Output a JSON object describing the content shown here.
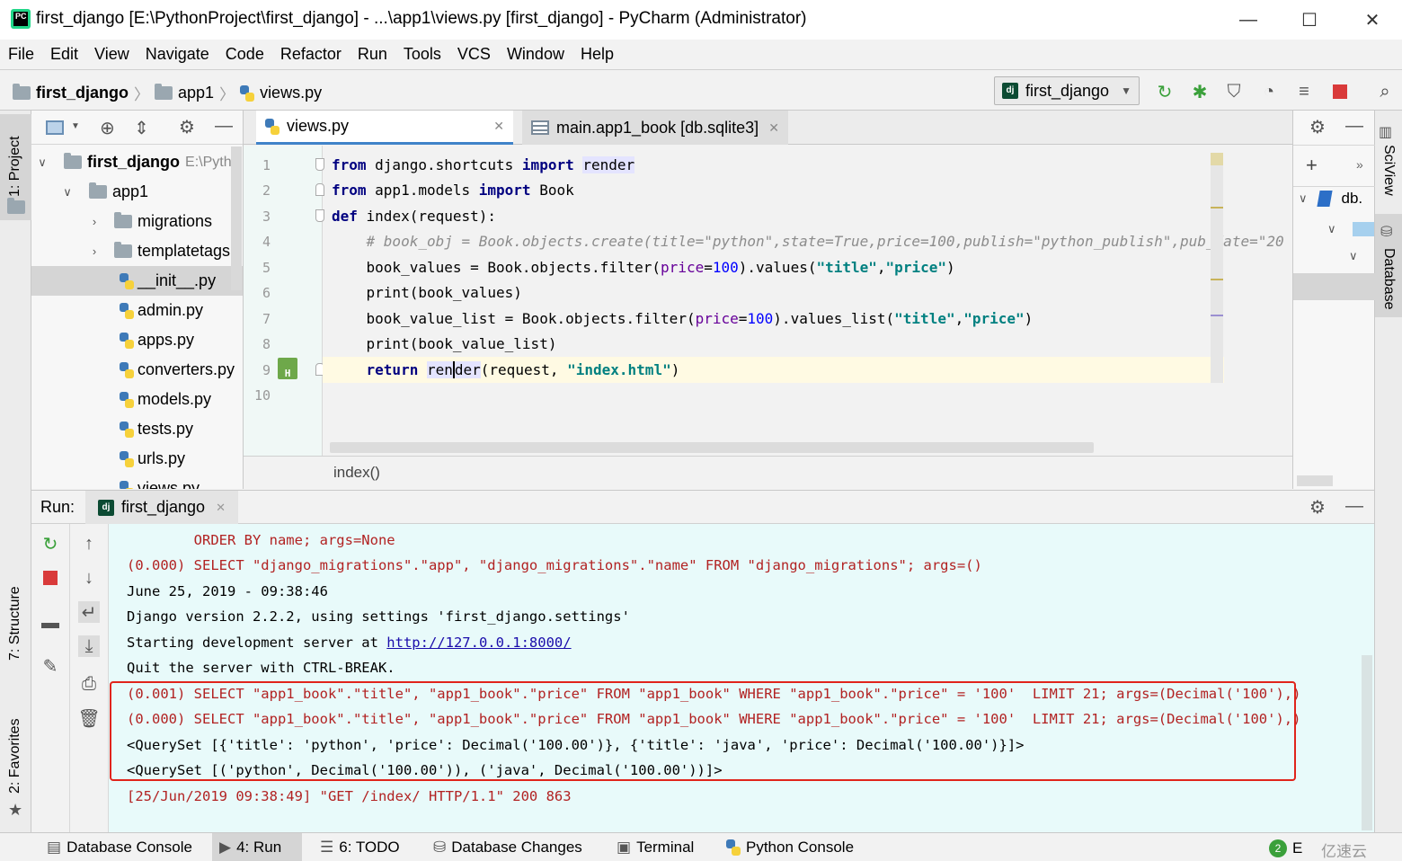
{
  "window": {
    "title": "first_django [E:\\PythonProject\\first_django] - ...\\app1\\views.py [first_django] - PyCharm (Administrator)",
    "icon_text": "PC",
    "minimize": "—",
    "maximize": "☐",
    "close": "✕"
  },
  "menu": [
    "File",
    "Edit",
    "View",
    "Navigate",
    "Code",
    "Refactor",
    "Run",
    "Tools",
    "VCS",
    "Window",
    "Help"
  ],
  "breadcrumb": {
    "project": "first_django",
    "folder": "app1",
    "file": "views.py"
  },
  "run_config": {
    "badge": "dj",
    "name": "first_django"
  },
  "side_tabs": {
    "project": "1: Project",
    "structure": "7: Structure",
    "favorites": "2: Favorites",
    "sciview": "SciView",
    "database": "Database"
  },
  "project_tree": {
    "root_name": "first_django",
    "root_path": "E:\\Pytho",
    "app": "app1",
    "items": [
      {
        "label": "migrations",
        "type": "folder"
      },
      {
        "label": "templatetags",
        "type": "folder"
      },
      {
        "label": "__init__.py",
        "type": "py"
      },
      {
        "label": "admin.py",
        "type": "py"
      },
      {
        "label": "apps.py",
        "type": "py"
      },
      {
        "label": "converters.py",
        "type": "py"
      },
      {
        "label": "models.py",
        "type": "py"
      },
      {
        "label": "tests.py",
        "type": "py"
      },
      {
        "label": "urls.py",
        "type": "py"
      },
      {
        "label": "views.py",
        "type": "py"
      }
    ]
  },
  "editor": {
    "tabs": [
      {
        "label": "views.py",
        "active": true,
        "close": "✕"
      },
      {
        "label": "main.app1_book [db.sqlite3]",
        "active": false,
        "close": "✕"
      }
    ],
    "line_numbers": [
      "1",
      "2",
      "3",
      "4",
      "5",
      "6",
      "7",
      "8",
      "9",
      "10"
    ],
    "context": "index()"
  },
  "db_panel": {
    "item": "db."
  },
  "run": {
    "label": "Run:",
    "tab": "first_django",
    "tab_close": "✕",
    "console": [
      {
        "text": "        ORDER BY name; args=None",
        "style": "red"
      },
      {
        "text": "(0.000) SELECT \"django_migrations\".\"app\", \"django_migrations\".\"name\" FROM \"django_migrations\"; args=()",
        "style": "red"
      },
      {
        "text": "June 25, 2019 - 09:38:46",
        "style": "blk"
      },
      {
        "text": "Django version 2.2.2, using settings 'first_django.settings'",
        "style": "blk"
      },
      {
        "text": "Starting development server at ",
        "style": "blk",
        "link": "http://127.0.0.1:8000/"
      },
      {
        "text": "Quit the server with CTRL-BREAK.",
        "style": "blk"
      },
      {
        "text": "(0.001) SELECT \"app1_book\".\"title\", \"app1_book\".\"price\" FROM \"app1_book\" WHERE \"app1_book\".\"price\" = '100'  LIMIT 21; args=(Decimal('100'),)",
        "style": "red"
      },
      {
        "text": "(0.000) SELECT \"app1_book\".\"title\", \"app1_book\".\"price\" FROM \"app1_book\" WHERE \"app1_book\".\"price\" = '100'  LIMIT 21; args=(Decimal('100'),)",
        "style": "red"
      },
      {
        "text": "<QuerySet [{'title': 'python', 'price': Decimal('100.00')}, {'title': 'java', 'price': Decimal('100.00')}]>",
        "style": "blk"
      },
      {
        "text": "<QuerySet [('python', Decimal('100.00')), ('java', Decimal('100.00'))]>",
        "style": "blk"
      },
      {
        "text": "[25/Jun/2019 09:38:49] \"GET /index/ HTTP/1.1\" 200 863",
        "style": "red"
      }
    ]
  },
  "statusbar": {
    "items": [
      "Database Console",
      "4: Run",
      "6: TODO",
      "Database Changes",
      "Terminal",
      "Python Console"
    ],
    "active": "4: Run",
    "badge": "2",
    "event": "E",
    "watermark": "亿速云"
  },
  "colors": {
    "keyword": "#000080",
    "string": "#008080",
    "number": "#0000ff",
    "console_bg": "#e8fafa",
    "highlight_box": "#e0241b"
  }
}
